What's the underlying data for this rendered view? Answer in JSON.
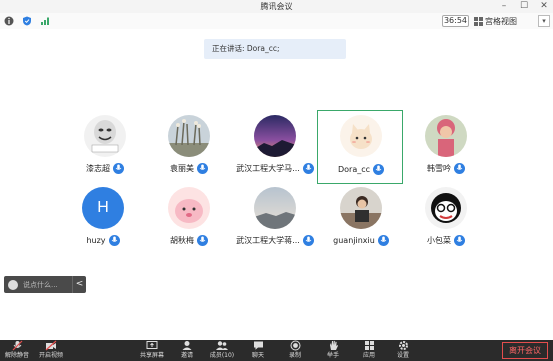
{
  "window": {
    "title": "腾讯会议"
  },
  "infobar": {
    "timer": "36:54",
    "view_mode": "宫格视图",
    "more": "▾"
  },
  "speaking": {
    "text": "正在讲话: Dora_cc;"
  },
  "participants": [
    {
      "name": "漆志超",
      "avatar": "meme-face"
    },
    {
      "name": "袁丽美",
      "avatar": "reeds-photo"
    },
    {
      "name": "武汉工程大学马...",
      "avatar": "sunset-photo"
    },
    {
      "name": "Dora_cc",
      "avatar": "cat-cartoon",
      "active": true
    },
    {
      "name": "韩雪吟",
      "avatar": "person-photo"
    },
    {
      "name": "huzy",
      "avatar": "letter",
      "letter": "H"
    },
    {
      "name": "胡秋梅",
      "avatar": "pink-cartoon"
    },
    {
      "name": "武汉工程大学蒋...",
      "avatar": "sky-photo"
    },
    {
      "name": "guanjinxiu",
      "avatar": "person-desk-photo"
    },
    {
      "name": "小包菜",
      "avatar": "masked-face"
    }
  ],
  "chat": {
    "placeholder": "说点什么...",
    "collapse": "<"
  },
  "toolbar": {
    "items": [
      {
        "label": "解除静音",
        "icon": "mic-muted-icon"
      },
      {
        "label": "开启视频",
        "icon": "video-off-icon"
      },
      {
        "label": "共享屏幕",
        "icon": "share-screen-icon"
      },
      {
        "label": "邀请",
        "icon": "invite-icon"
      },
      {
        "label": "成员(10)",
        "icon": "members-icon"
      },
      {
        "label": "聊天",
        "icon": "chat-icon"
      },
      {
        "label": "录制",
        "icon": "record-icon"
      },
      {
        "label": "举手",
        "icon": "raise-hand-icon"
      },
      {
        "label": "应用",
        "icon": "apps-icon"
      },
      {
        "label": "设置",
        "icon": "settings-icon"
      }
    ],
    "leave": "离开会议"
  },
  "colors": {
    "mic_blue": "#2f7fe1",
    "active_border": "#3aa86a",
    "leave_red": "#e44d4d",
    "toolbar_bg": "#2b2b2b"
  }
}
